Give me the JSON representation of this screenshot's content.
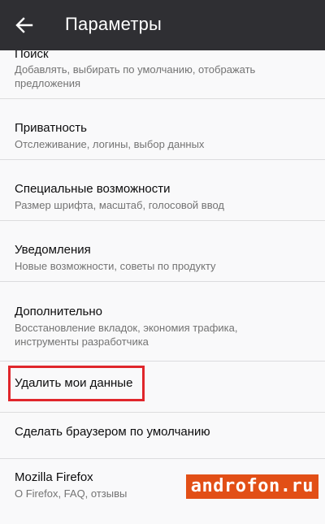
{
  "appbar": {
    "title": "Параметры"
  },
  "settings": [
    {
      "title": "Поиск",
      "subtitle": "Добавлять, выбирать по умолчанию, отображать предложения"
    },
    {
      "title": "Приватность",
      "subtitle": "Отслеживание, логины, выбор данных"
    },
    {
      "title": "Специальные возможности",
      "subtitle": "Размер шрифта, масштаб, голосовой ввод"
    },
    {
      "title": "Уведомления",
      "subtitle": "Новые возможности, советы по продукту"
    },
    {
      "title": "Дополнительно",
      "subtitle": "Восстановление вкладок, экономия трафика, инструменты разработчика"
    },
    {
      "title": "Удалить мои данные"
    },
    {
      "title": "Сделать браузером по умолчанию"
    },
    {
      "title": "Mozilla Firefox",
      "subtitle": "О Firefox, FAQ, отзывы"
    }
  ],
  "watermark": "androfon.ru",
  "colors": {
    "appbar": "#2f2f33",
    "background": "#f9f9fa",
    "highlight_border": "#e0262b",
    "watermark_bg": "#e24f16"
  }
}
